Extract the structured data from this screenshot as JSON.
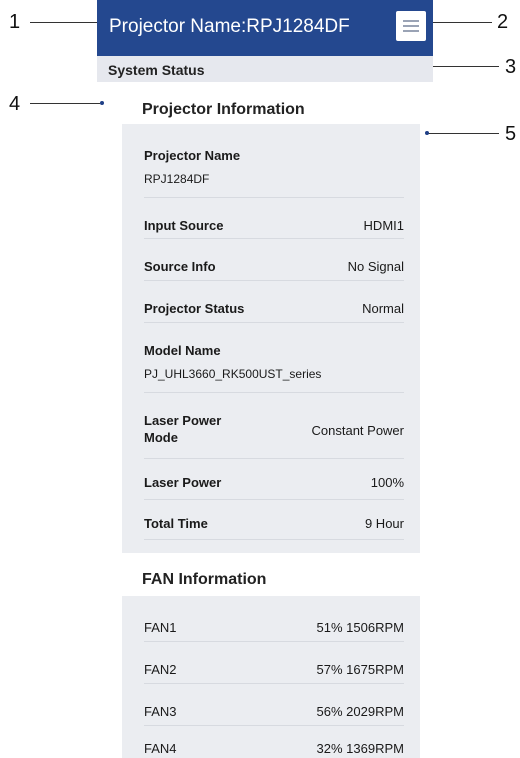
{
  "callouts": [
    "1",
    "2",
    "3",
    "4",
    "5"
  ],
  "header": {
    "title": "Projector Name:RPJ1284DF",
    "menu_icon": "hamburger-menu-icon"
  },
  "status_bar": {
    "label": "System Status"
  },
  "projector_info": {
    "title": "Projector Information",
    "rows": [
      {
        "label": "Projector Name",
        "value": "RPJ1284DF"
      },
      {
        "label": "Input Source",
        "value": "HDMI1"
      },
      {
        "label": "Source Info",
        "value": "No Signal"
      },
      {
        "label": "Projector Status",
        "value": "Normal"
      },
      {
        "label": "Model Name",
        "value": "PJ_UHL3660_RK500UST_series"
      },
      {
        "label": "Laser Power Mode",
        "value": "Constant Power"
      },
      {
        "label": "Laser Power",
        "value": "100%"
      },
      {
        "label": "Total Time",
        "value": "9 Hour"
      }
    ]
  },
  "fan_info": {
    "title": "FAN Information",
    "rows": [
      {
        "label": "FAN1",
        "value": "51% 1506RPM"
      },
      {
        "label": "FAN2",
        "value": "57% 1675RPM"
      },
      {
        "label": "FAN3",
        "value": "56% 2029RPM"
      },
      {
        "label": "FAN4",
        "value": "32% 1369RPM"
      }
    ]
  }
}
